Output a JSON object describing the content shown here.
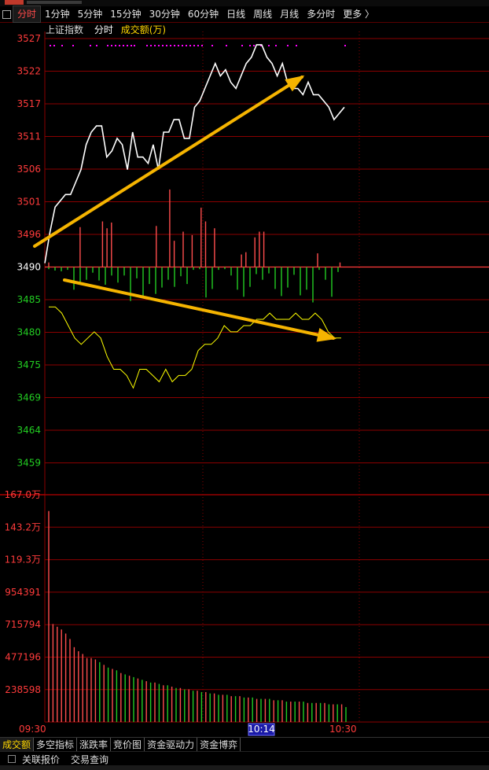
{
  "tabs": [
    "分时",
    "1分钟",
    "5分钟",
    "15分钟",
    "30分钟",
    "60分钟",
    "日线",
    "周线",
    "月线",
    "多分时",
    "更多 〉"
  ],
  "info": {
    "index_name": "上证指数",
    "mode": "分时",
    "indicator": "成交额(万)"
  },
  "price_axis": [
    "3527",
    "3522",
    "3517",
    "3511",
    "3506",
    "3501",
    "3496",
    "3490",
    "3485",
    "3480",
    "3475",
    "3469",
    "3464",
    "3459"
  ],
  "volume_axis": [
    "167.0万",
    "143.2万",
    "119.3万",
    "954391",
    "715794",
    "477196",
    "238598"
  ],
  "time_axis": {
    "start": "09:30",
    "cursor": "10:14",
    "end": "10:30"
  },
  "bottom_tabs": [
    "成交额",
    "多空指标",
    "涨跌率",
    "竞价图",
    "资金驱动力",
    "资金博弈"
  ],
  "footer": {
    "item1": "关联报价",
    "item2": "交易查询"
  },
  "colors": {
    "price_line": "#ffffff",
    "avg_line": "#ffff00",
    "up": "#ff4d4d",
    "down": "#22cc22",
    "arrow": "#f5b400",
    "grid": "#8b0000",
    "marker": "#ff00ff",
    "axis_red": "#ff3b3b",
    "axis_green": "#22cc22"
  },
  "chart_data": {
    "type": "line",
    "price_series": [
      3491,
      3496,
      3500,
      3501,
      3502,
      3502,
      3504,
      3506,
      3510,
      3512,
      3513,
      3513,
      3508,
      3509,
      3511,
      3510,
      3506,
      3512,
      3508,
      3508,
      3507,
      3510,
      3506,
      3512,
      3512,
      3514,
      3514,
      3511,
      3511,
      3516,
      3517,
      3519,
      3521,
      3523,
      3521,
      3522,
      3520,
      3519,
      3521,
      3523,
      3524,
      3526,
      3526,
      3524,
      3523,
      3521,
      3523,
      3520,
      3519,
      3519,
      3518,
      3520,
      3518,
      3518,
      3517,
      3516,
      3514,
      3515,
      3516
    ],
    "avg_series": [
      3484,
      3484,
      3483,
      3481,
      3479,
      3478,
      3479,
      3480,
      3479,
      3476,
      3474,
      3474,
      3473,
      3471,
      3474,
      3474,
      3473,
      3472,
      3474,
      3472,
      3473,
      3473,
      3474,
      3477,
      3478,
      3478,
      3479,
      3481,
      3480,
      3480,
      3481,
      3481,
      3482,
      3482,
      3483,
      3482,
      3482,
      3482,
      3483,
      3482,
      3482,
      3483,
      3482,
      3480,
      3479,
      3479
    ],
    "breadth_bars_up": [
      0.4,
      0,
      0,
      0,
      0,
      0,
      0,
      3.5,
      0,
      0,
      0,
      0,
      4,
      3.4,
      3.9,
      0,
      0,
      0,
      0,
      0,
      0,
      0,
      0,
      0,
      3.6,
      0,
      0,
      6.8,
      2.3,
      0,
      3.1,
      0,
      2.8,
      0,
      5.2,
      4,
      0,
      3.4,
      0,
      0,
      0,
      0,
      0,
      1.1,
      1.3,
      0,
      2.6,
      3.1,
      3.1,
      0,
      0,
      0,
      0,
      0,
      0,
      0,
      0,
      0,
      0,
      0,
      1.2,
      0,
      0,
      0,
      0,
      0.4,
      0
    ],
    "breadth_bars_down": [
      -0.3,
      -0.5,
      -0.6,
      -0.4,
      -3.2,
      -2.2,
      -1.8,
      -0.8,
      -1.9,
      -2.5,
      -1.2,
      -2.2,
      -1.2,
      -4.8,
      -1.6,
      -4.1,
      -2.4,
      -3.8,
      -2.9,
      -1.8,
      -2.8,
      -1.3,
      -2.4,
      -0.4,
      -0.3,
      -4.3,
      -3.1,
      -0.4,
      -0.3,
      -1.2,
      -3.2,
      -4.2,
      -2.8,
      -1.0,
      -1.8,
      -0.9,
      -3.1,
      -4.1,
      -2.9,
      -1.1,
      -4.0,
      -3.2,
      -5.0,
      -0.4,
      -1.8,
      -4.2,
      -0.7
    ],
    "volume_bars": [
      1550000,
      720000,
      700000,
      680000,
      650000,
      610000,
      550000,
      520000,
      500000,
      470000,
      470000,
      460000,
      440000,
      420000,
      400000,
      390000,
      380000,
      360000,
      350000,
      340000,
      330000,
      320000,
      310000,
      300000,
      290000,
      290000,
      280000,
      270000,
      270000,
      260000,
      250000,
      250000,
      240000,
      240000,
      230000,
      230000,
      220000,
      220000,
      210000,
      210000,
      200000,
      200000,
      200000,
      190000,
      190000,
      190000,
      180000,
      180000,
      180000,
      170000,
      170000,
      170000,
      170000,
      160000,
      160000,
      160000,
      150000,
      150000,
      150000,
      150000,
      150000,
      140000,
      140000,
      140000,
      140000,
      140000,
      130000,
      130000,
      130000,
      130000,
      110000
    ],
    "ylim_price": [
      3459,
      3527
    ],
    "ylim_volume": [
      0,
      1670000
    ],
    "xlabel": "",
    "ylabel": "",
    "x_ticks": [
      "09:30",
      "10:14",
      "10:30"
    ]
  }
}
